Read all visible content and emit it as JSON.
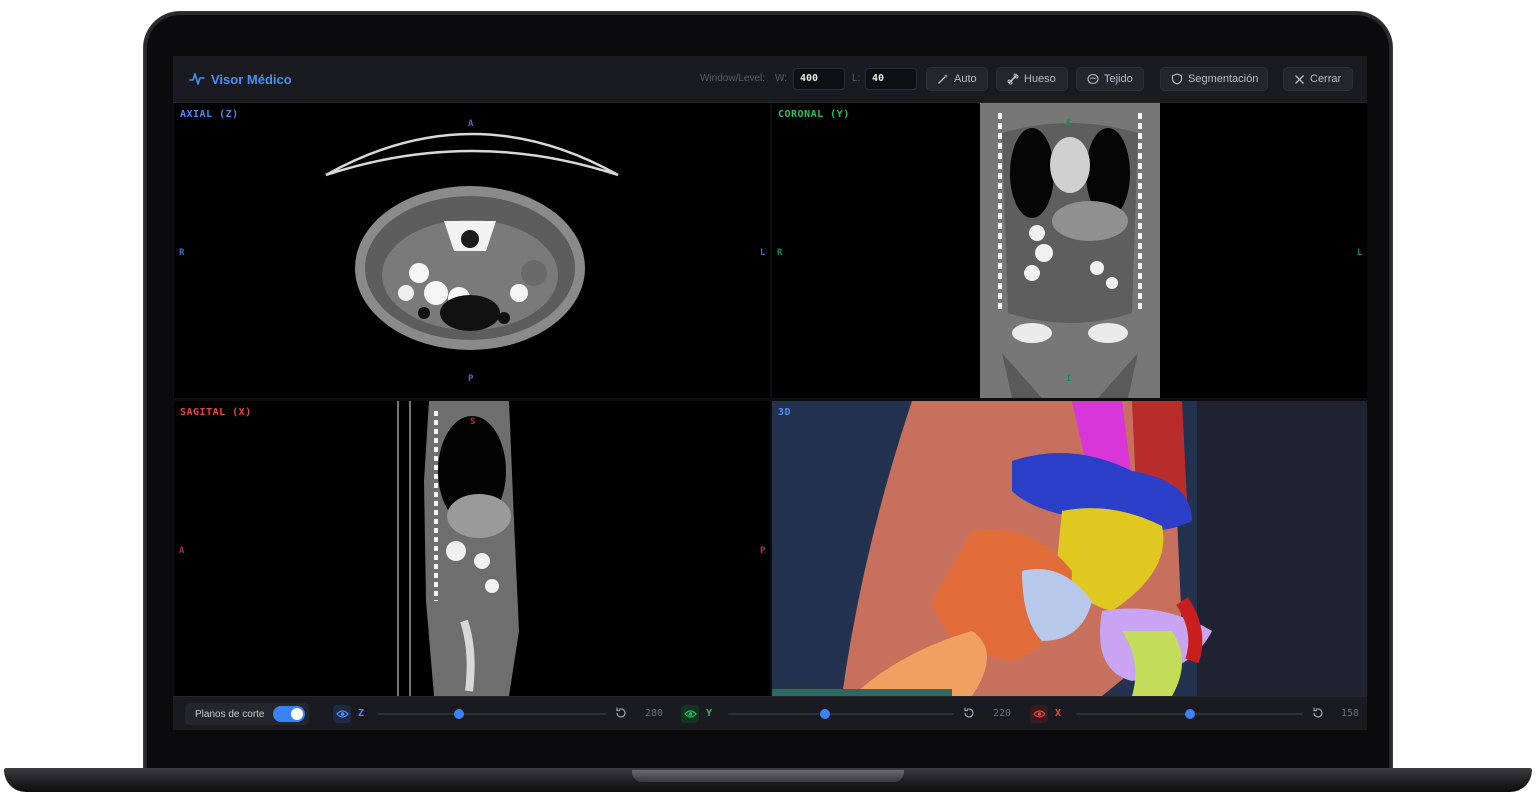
{
  "app": {
    "title": "Visor Médico"
  },
  "window_level": {
    "label": "Window/Level:",
    "w_label": "W:",
    "w_value": "400",
    "l_label": "L:",
    "l_value": "40"
  },
  "toolbar": {
    "auto": "Auto",
    "hueso": "Hueso",
    "tejido": "Tejido",
    "segmentacion": "Segmentación",
    "cerrar": "Cerrar"
  },
  "viewports": {
    "axial": {
      "label": "AXIAL (Z)",
      "color": "#4a8ff7",
      "top": "A",
      "bottom": "P",
      "left": "R",
      "right": "L"
    },
    "coronal": {
      "label": "CORONAL (Y)",
      "color": "#22c55e",
      "top": "S",
      "bottom": "I",
      "left": "R",
      "right": "L"
    },
    "sagital": {
      "label": "SAGITAL (X)",
      "color": "#ef4444",
      "top": "S",
      "left": "A",
      "right": "P"
    },
    "view3d": {
      "label": "3D",
      "color": "#4a8ff7"
    }
  },
  "bottom": {
    "planos_label": "Planos de corte",
    "planos_on": true,
    "sliders": [
      {
        "axis": "Z",
        "value": "280",
        "position": 0.356,
        "color": "#4a8ff7"
      },
      {
        "axis": "Y",
        "value": "220",
        "position": 0.429,
        "color": "#22c55e"
      },
      {
        "axis": "X",
        "value": "158",
        "position": 0.5,
        "color": "#ef4444"
      }
    ]
  }
}
